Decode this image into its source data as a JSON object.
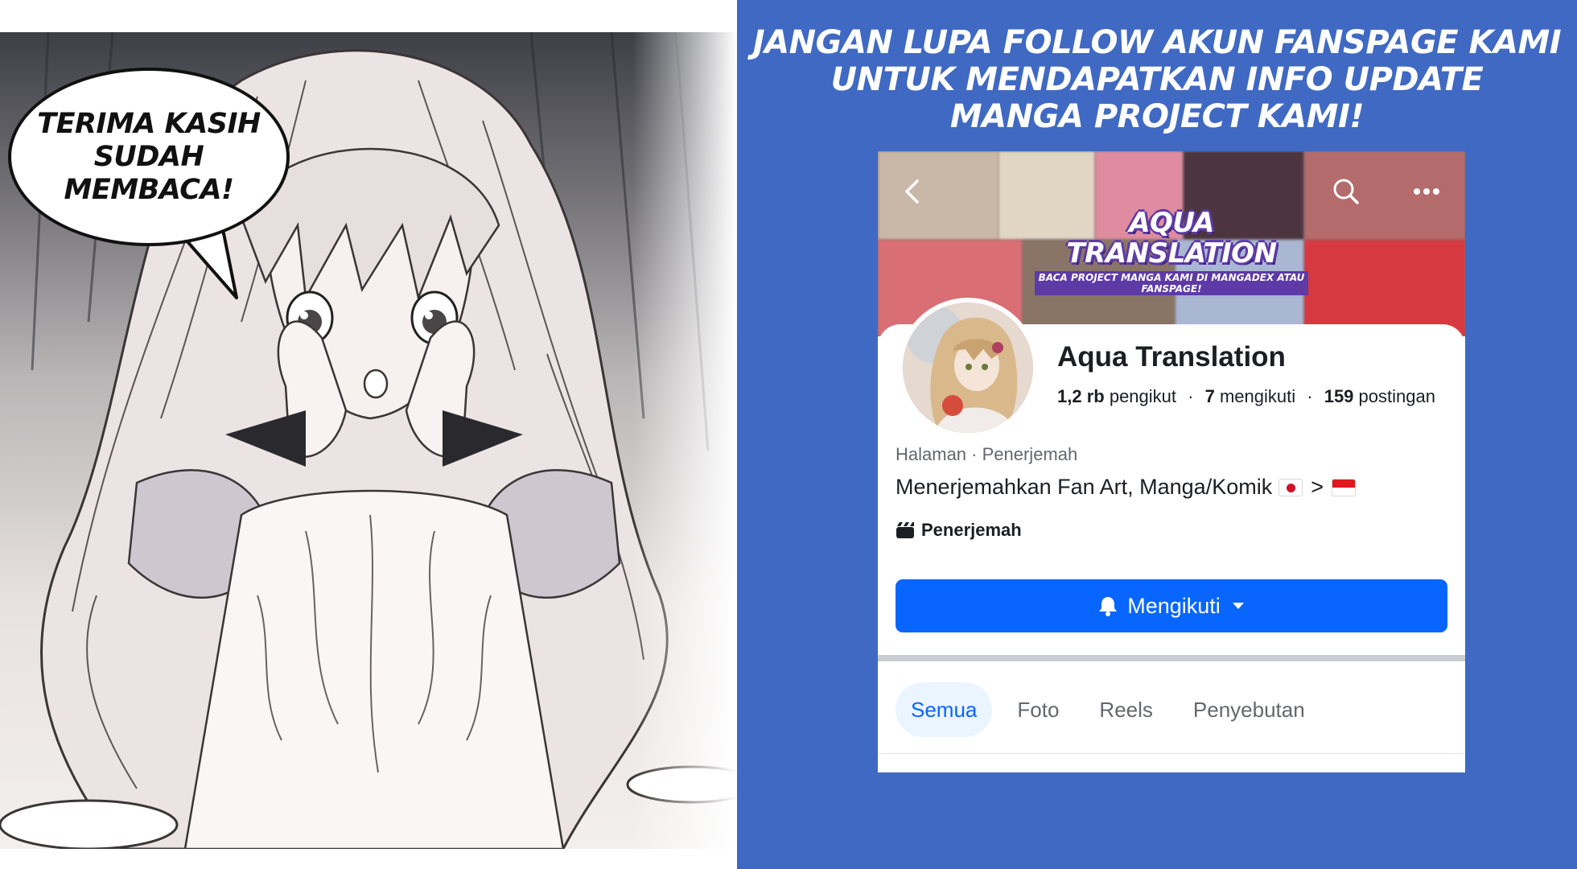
{
  "manga": {
    "speech_lines": [
      "TERIMA KASIH",
      "SUDAH",
      "MEMBACA!"
    ]
  },
  "promo": {
    "heading_lines": [
      "JANGAN LUPA FOLLOW AKUN FANSPAGE KAMI",
      "UNTUK MENDAPATKAN INFO UPDATE",
      "MANGA PROJECT KAMI!"
    ],
    "background_color": "#3f69c2"
  },
  "facebook_page": {
    "cover": {
      "title": "AQUA TRANSLATION",
      "subtitle": "BACA PROJECT MANGA KAMI DI MANGADEX ATAU FANSPAGE!",
      "back_icon": "chevron-left-icon",
      "search_icon": "search-icon",
      "more_icon": "more-horizontal-icon"
    },
    "name": "Aqua Translation",
    "stats": {
      "followers_value": "1,2 rb",
      "followers_label": "pengikut",
      "following_value": "7",
      "following_label": "mengikuti",
      "posts_value": "159",
      "posts_label": "postingan",
      "separator": "·"
    },
    "category_line": "Halaman · Penerjemah",
    "bio": {
      "text": "Menerjemahkan Fan Art, Manga/Komik",
      "from_flag": "japan-flag-icon",
      "arrow": ">",
      "to_flag": "indonesia-flag-icon"
    },
    "category_badge": {
      "icon": "clapperboard-icon",
      "label": "Penerjemah"
    },
    "follow_button": {
      "icon": "bell-icon",
      "label": "Mengikuti",
      "caret_icon": "caret-down-icon",
      "color": "#0866ff"
    },
    "tabs": [
      {
        "label": "Semua",
        "active": true
      },
      {
        "label": "Foto",
        "active": false
      },
      {
        "label": "Reels",
        "active": false
      },
      {
        "label": "Penyebutan",
        "active": false
      }
    ]
  }
}
